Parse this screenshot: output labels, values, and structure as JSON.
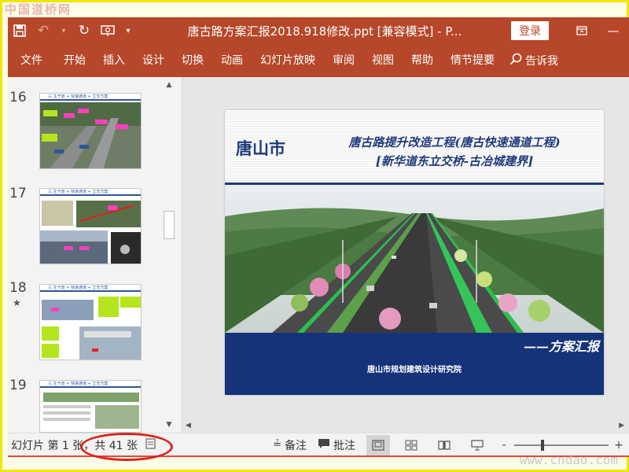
{
  "watermarks": {
    "top_left": "中国道桥网",
    "bottom_right": "www.cndao.com"
  },
  "titlebar": {
    "icons": [
      "save-icon",
      "undo-icon",
      "redo-icon",
      "present-icon",
      "customize-icon"
    ],
    "document_title": "唐古路方案汇报2018.918修改.ppt [兼容模式] - P...",
    "login_label": "登录",
    "window_icons": [
      "restore-icon"
    ]
  },
  "ribbon": {
    "tabs": [
      "文件",
      "开始",
      "插入",
      "设计",
      "切换",
      "动画",
      "幻灯片放映",
      "审阅",
      "视图",
      "帮助",
      "情节提要"
    ],
    "tell_me": "告诉我"
  },
  "thumbnails": [
    {
      "number": "16",
      "header": "三.主干道 + 快速通道 + 立交方案"
    },
    {
      "number": "17",
      "header": "三.主干道 + 快速通道 + 立交方案"
    },
    {
      "number": "18",
      "header": "三.主干道 + 快速通道 + 立交方案",
      "has_animation": true
    },
    {
      "number": "19",
      "header": "三.主干道 + 快速通道 + 立交方案"
    }
  ],
  "slide": {
    "city": "唐山市",
    "title_line1": "唐古路提升改造工程(唐古快速通道工程)",
    "title_line2": "[新华道东立交桥-古冶城建界]",
    "plan_label": "——方案汇报",
    "institute": "唐山市规划建筑设计研究院",
    "colors": {
      "navy": "#14337a",
      "title": "#1f3a7a"
    }
  },
  "statusbar": {
    "slide_info": "幻灯片 第 1 张，共 41 张",
    "notes_label": "备注",
    "comments_label": "批注",
    "views": [
      "normal-view-icon",
      "slide-sorter-icon",
      "reading-view-icon",
      "slideshow-icon"
    ],
    "zoom_minus": "-",
    "zoom_plus": "+"
  },
  "accent": "#b7472a"
}
